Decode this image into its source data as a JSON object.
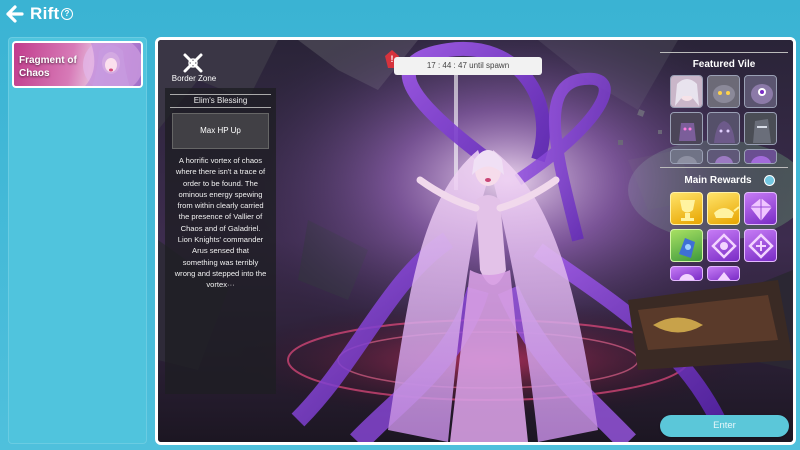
{
  "header": {
    "title": "Rift",
    "back_icon": "arrow-left-icon",
    "help_icon": "question-icon",
    "help_glyph": "?"
  },
  "zone_list": [
    {
      "label": "Fragment of Chaos",
      "selected": true
    }
  ],
  "border_zone": {
    "label": "Border Zone",
    "icon": "crossed-swords-icon"
  },
  "blessing": {
    "title": "Elim's Blessing",
    "effect": "Max HP Up"
  },
  "lore": "A horrific vortex of chaos\nwhere there isn't a trace of\norder to be found. The\nominous energy spewing\nfrom within clearly carried\nthe presence of Vallier of\nChaos and of Galadriel.\nLion Knights' commander\nArus sensed that\nsomething was terribly\nwrong and stepped into the\nvortex···",
  "timer": {
    "text": "17 : 44 : 47 until spawn",
    "icon": "alert-icon"
  },
  "featured_vile": {
    "title": "Featured Vile",
    "tiles": [
      {
        "icon": "pale-haired-girl-portrait"
      },
      {
        "icon": "grey-beast-portrait"
      },
      {
        "icon": "purple-cyclops-portrait"
      },
      {
        "icon": "purple-golem-portrait"
      },
      {
        "icon": "shadow-creature-portrait"
      },
      {
        "icon": "dark-knight-portrait"
      },
      {
        "icon": "grey-creature-portrait"
      },
      {
        "icon": "purple-wisp-portrait"
      },
      {
        "icon": "violet-creature-portrait"
      }
    ]
  },
  "main_rewards": {
    "title": "Main Rewards",
    "info_icon": "info-icon",
    "tiles": [
      {
        "icon": "golden-trophy-icon",
        "tone": "gold"
      },
      {
        "icon": "magic-lamp-icon",
        "tone": "gold"
      },
      {
        "icon": "purple-gem-icon",
        "tone": "purple"
      },
      {
        "icon": "blue-gauntlet-icon",
        "tone": "green"
      },
      {
        "icon": "purple-rune-icon",
        "tone": "purple"
      },
      {
        "icon": "purple-sigil-icon",
        "tone": "purple"
      },
      {
        "icon": "purple-orb-icon",
        "tone": "purple"
      },
      {
        "icon": "purple-crest-icon",
        "tone": "purple"
      }
    ]
  },
  "enter_button": {
    "label": "Enter"
  },
  "colors": {
    "background": "#3ab3d3",
    "accent": "#5bc7d9",
    "boss_purple": "#8a3fd1"
  }
}
